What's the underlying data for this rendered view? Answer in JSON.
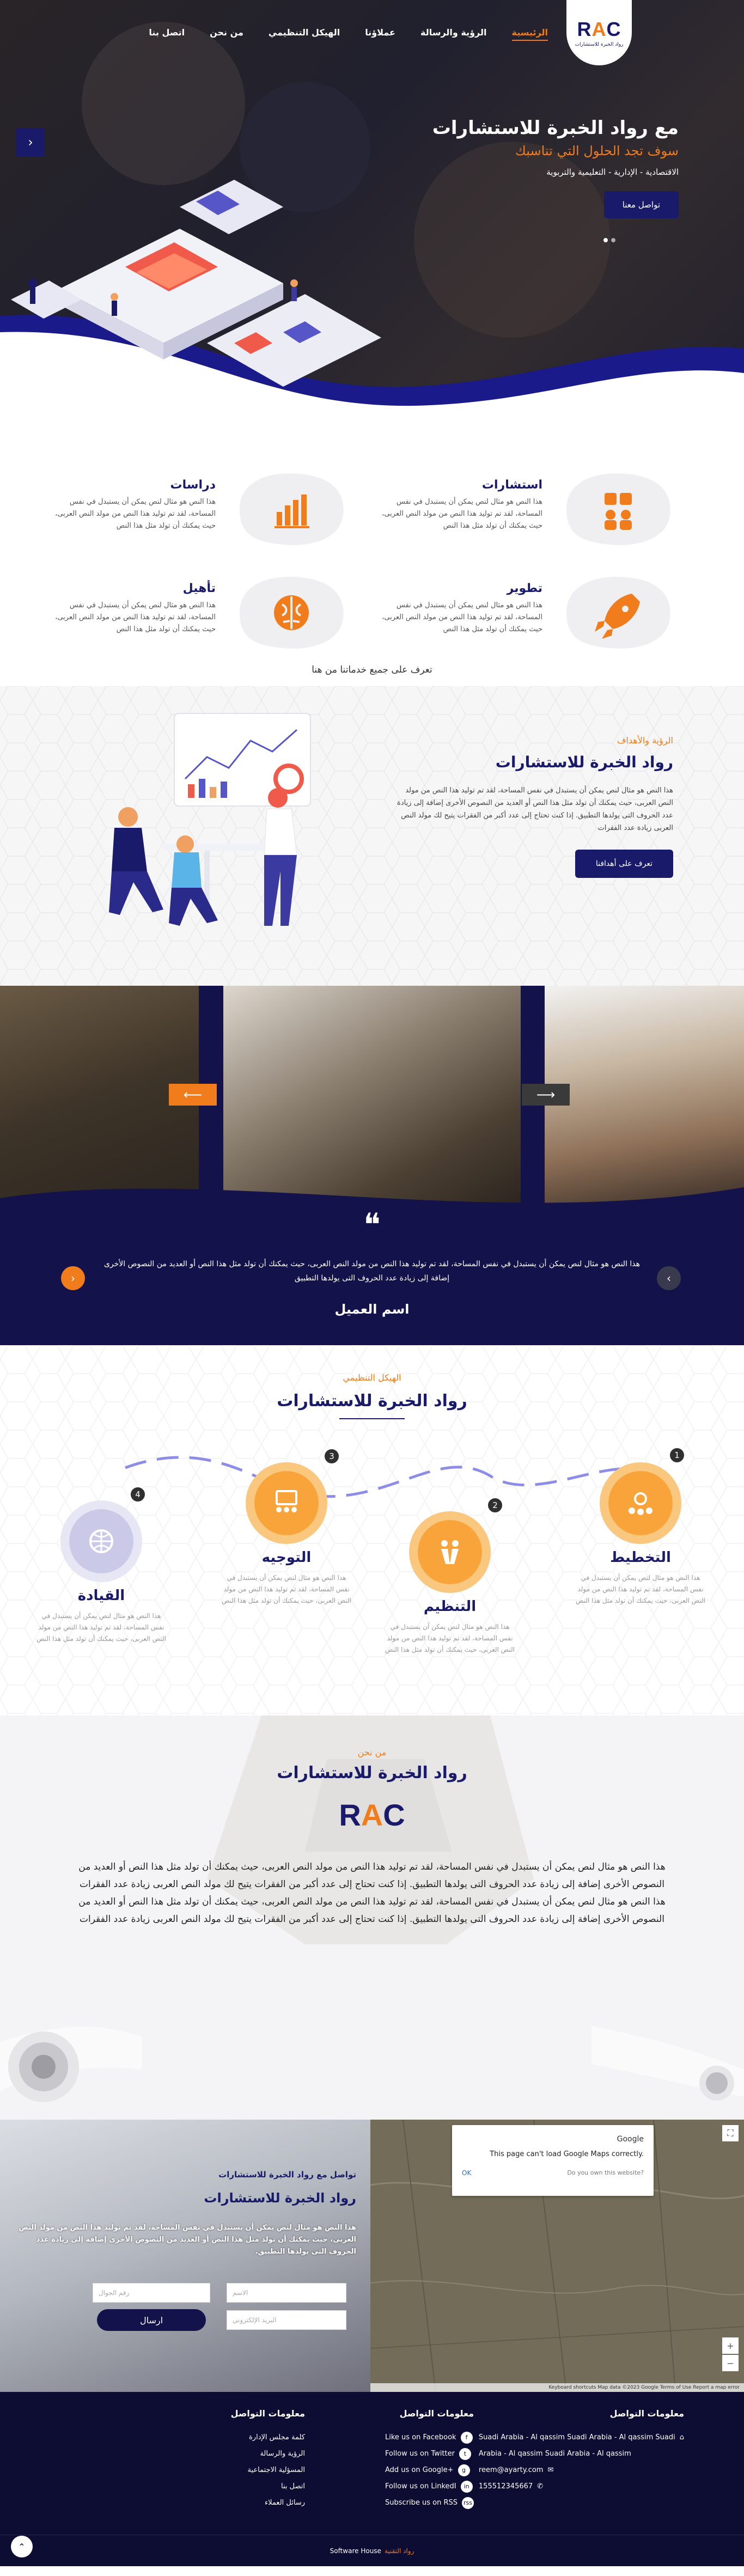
{
  "header": {
    "logo_text": "RAC",
    "logo_sub": "رواد الخبرة للاستشارات",
    "nav": [
      {
        "label": "الرئيسية",
        "active": true
      },
      {
        "label": "الرؤية والرسالة"
      },
      {
        "label": "عملاؤنا"
      },
      {
        "label": "الهيكل التنظيمي"
      },
      {
        "label": "من نحن"
      },
      {
        "label": "اتصل بنا"
      }
    ]
  },
  "hero": {
    "title": "مع رواد الخبرة للاستشارات",
    "subtitle": "سوف تجد الحلول التي تناسبك",
    "desc": "الاقتصادية - الإدارية - التعليمية والتربوية",
    "button": "تواصل معنا",
    "arrow": "‹"
  },
  "services": {
    "items": [
      {
        "title": "استشارات",
        "desc": "هذا النص هو مثال لنص يمكن أن يستبدل في نفس المساحة، لقد تم توليد هذا النص من مولد النص العربى، حيث يمكنك أن تولد مثل هذا النص",
        "icon": "consulting-icon"
      },
      {
        "title": "دراسات",
        "desc": "هذا النص هو مثال لنص يمكن أن يستبدل في نفس المساحة، لقد تم توليد هذا النص من مولد النص العربى، حيث يمكنك أن تولد مثل هذا النص",
        "icon": "chart-icon"
      },
      {
        "title": "تطوير",
        "desc": "هذا النص هو مثال لنص يمكن أن يستبدل في نفس المساحة، لقد تم توليد هذا النص من مولد النص العربى، حيث يمكنك أن تولد مثل هذا النص",
        "icon": "rocket-icon"
      },
      {
        "title": "تأهيل",
        "desc": "هذا النص هو مثال لنص يمكن أن يستبدل في نفس المساحة، لقد تم توليد هذا النص من مولد النص العربى، حيث يمكنك أن تولد مثل هذا النص",
        "icon": "brain-icon"
      }
    ],
    "more": "تعرف على جميع خدماتنا من هنا"
  },
  "vision": {
    "kicker": "الرؤية والأهداف",
    "title": "رواد الخبرة للاستشارات",
    "desc": "هذا النص هو مثال لنص يمكن أن يستبدل في نفس المساحة، لقد تم توليد هذا النص من مولد النص العربى، حيث يمكنك أن تولد مثل هذا النص أو العديد من النصوص الأخرى إضافة إلى زيادة عدد الحروف التى يولدها التطبيق. إذا كنت تحتاج إلى عدد أكبر من الفقرات يتيح لك مولد النص العربى زيادة عدد الفقرات",
    "button": "تعرف على أهدافنا"
  },
  "testimonial": {
    "quote_mark": "❝",
    "text": "هذا النص هو مثال لنص يمكن أن يستبدل في نفس المساحة، لقد تم توليد هذا النص من مولد النص العربى، حيث يمكنك أن تولد مثل هذا النص أو العديد من النصوص الأخرى إضافة إلى زيادة عدد الحروف التى يولدها التطبيق",
    "name": "اسم العميل",
    "arrow_left": "⟵",
    "arrow_right": "⟶",
    "nav_prev": "‹",
    "nav_next": "›"
  },
  "org": {
    "kicker": "الهيكل التنظيمي",
    "title": "رواد الخبرة للاستشارات",
    "steps": [
      {
        "num": "1",
        "title": "التخطيط",
        "desc": "هذا النص هو مثال لنص يمكن أن يستبدل في نفس المساحة، لقد تم توليد هذا النص من مولد النص العربى، حيث يمكنك أن تولد مثل هذا النص"
      },
      {
        "num": "2",
        "title": "التنظيم",
        "desc": "هذا النص هو مثال لنص يمكن أن يستبدل في نفس المساحة، لقد تم توليد هذا النص من مولد النص العربى، حيث يمكنك أن تولد مثل هذا النص"
      },
      {
        "num": "3",
        "title": "التوجيه",
        "desc": "هذا النص هو مثال لنص يمكن أن يستبدل في نفس المساحة، لقد تم توليد هذا النص من مولد النص العربى، حيث يمكنك أن تولد مثل هذا النص"
      },
      {
        "num": "4",
        "title": "القيادة",
        "desc": "هذا النص هو مثال لنص يمكن أن يستبدل في نفس المساحة، لقد تم توليد هذا النص من مولد النص العربى، حيث يمكنك أن تولد مثل هذا النص"
      }
    ]
  },
  "about": {
    "kicker": "من نحن",
    "title": "رواد الخبرة للاستشارات",
    "logo": "RAC",
    "text": "هذا النص هو مثال لنص يمكن أن يستبدل في نفس المساحة، لقد تم توليد هذا النص من مولد النص العربى، حيث يمكنك أن تولد مثل هذا النص أو العديد من النصوص الأخرى إضافة إلى زيادة عدد الحروف التى يولدها التطبيق. إذا كنت تحتاج إلى عدد أكبر من الفقرات يتيح لك مولد النص العربى زيادة عدد الفقرات هذا النص هو مثال لنص يمكن أن يستبدل في نفس المساحة، لقد تم توليد هذا النص من مولد النص العربى، حيث يمكنك أن تولد مثل هذا النص أو العديد من النصوص الأخرى إضافة إلى زيادة عدد الحروف التى يولدها التطبيق. إذا كنت تحتاج إلى عدد أكبر من الفقرات يتيح لك مولد النص العربى زيادة عدد الفقرات"
  },
  "contact": {
    "kicker": "تواصل مع رواد الخبرة للاستشارات",
    "title": "رواد الخبرة للاستشارات",
    "desc": "هذا النص هو مثال لنص يمكن أن يستبدل في نفس المساحة، لقد تم توليد هذا النص من مولد النص العربى، حيث يمكنك أن تولد مثل هذا النص أو العديد من النصوص الأخرى إضافة إلى زيادة عدد الحروف التى يولدها التطبيق.",
    "name_placeholder": "الاسم",
    "phone_placeholder": "رقم الجوال",
    "email_placeholder": "البريد الإلكتروني",
    "send": "ارسال",
    "map": {
      "brand": "Google",
      "message": "This page can't load Google Maps correctly.",
      "ok": "OK",
      "own": "Do you own this website?",
      "zoom_in": "+",
      "zoom_out": "−",
      "fullscreen": "⛶",
      "footer": "Keyboard shortcuts  Map data ©2023 Google  Terms of Use  Report a map error"
    }
  },
  "footer": {
    "col1": {
      "title": "معلومات التواصل",
      "items": [
        "كلمة مجلس الإدارة",
        "الرؤية والرسالة",
        "المسؤلية الاجتماعية",
        "اتصل بنا",
        "رسائل العملاء"
      ]
    },
    "col2": {
      "title": "معلومات التواصل",
      "items": [
        {
          "label": "Like us on Facebook",
          "icon": "f"
        },
        {
          "label": "Follow us on Twitter",
          "icon": "t"
        },
        {
          "label": "Add us on Google+",
          "icon": "g"
        },
        {
          "label": "Follow us on LinkedI",
          "icon": "in"
        },
        {
          "label": "Subscribe us on RSS",
          "icon": "rss"
        }
      ]
    },
    "col3": {
      "title": "معلومات التواصل",
      "items": [
        {
          "label": "Suadi Arabia - Al qassim Suadi Arabia - Al qassim Suadi",
          "icon": "⌂"
        },
        {
          "label": "Arabia - Al qassim Suadi Arabia - Al qassim",
          "icon": ""
        },
        {
          "label": "reem@ayarty.com",
          "icon": "✉"
        },
        {
          "label": "155512345667",
          "icon": "✆"
        }
      ]
    },
    "credit": "Software House",
    "credit_brand": "رواد التقنية",
    "to_top": "⌃"
  }
}
